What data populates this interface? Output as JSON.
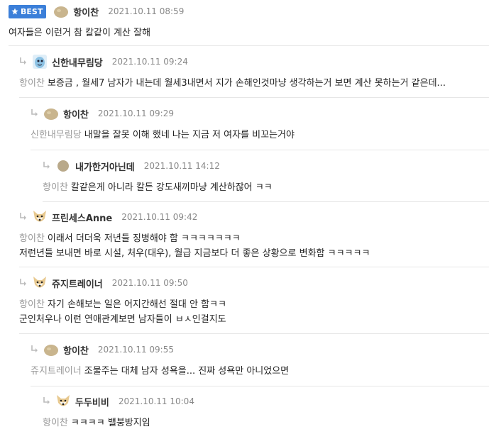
{
  "colors": {
    "best_badge": "#3b7fd9",
    "mention": "#999999",
    "meta": "#888888",
    "divider": "#e6e6e6"
  },
  "comments": [
    {
      "badge": "BEST",
      "nick": "항이찬",
      "time": "2021.10.11 08:59",
      "avatar": "potato-avatar",
      "body": "여자들은 이런거 참 칼같이 계산 잘해"
    },
    {
      "nick": "신한내무림당",
      "time": "2021.10.11 09:24",
      "avatar": "blue-character-avatar",
      "mention": "항이찬",
      "body": "보증금 , 월세7 남자가 내는데 월세3내면서 지가 손해인것마냥 생각하는거 보면 계산 못하는거 같은데..."
    },
    {
      "nick": "항이찬",
      "time": "2021.10.11 09:29",
      "avatar": "potato-avatar",
      "mention": "신한내무림당",
      "body": "내말을 잘못 이해 했네 나는 지금 저 여자를 비꼬는거야"
    },
    {
      "nick": "내가한거아닌데",
      "time": "2021.10.11 14:12",
      "avatar": "circle-avatar",
      "mention": "항이찬",
      "body": "칼같은게 아니라 칼든 강도새끼마냥 계산하잖어 ㅋㅋ"
    },
    {
      "nick": "프린세스Anne",
      "time": "2021.10.11 09:42",
      "avatar": "dog-avatar",
      "mention": "항이찬",
      "body": "이래서 더더욱 저년들 징병해야 함 ㅋㅋㅋㅋㅋㅋㅋ",
      "body2": "저런년들 보내면 바로 시설, 처우(대우), 월급 지금보다 더 좋은 상황으로 변화함 ㅋㅋㅋㅋㅋ"
    },
    {
      "nick": "쥬지트레이너",
      "time": "2021.10.11 09:50",
      "avatar": "dog-avatar",
      "mention": "항이찬",
      "body": "자기 손해보는 일은 어지간해선 절대 안 함ㅋㅋ",
      "body2": "군인처우나 이런 연애관계보면 남자들이 ㅂㅅ인걸지도"
    },
    {
      "nick": "항이찬",
      "time": "2021.10.11 09:55",
      "avatar": "potato-avatar",
      "mention": "쥬지트레이너",
      "body": "조물주는 대체 남자 성욕을... 진짜 성욕만 아니었으면"
    },
    {
      "nick": "두두비비",
      "time": "2021.10.11 10:04",
      "avatar": "dog-avatar",
      "mention": "항이찬",
      "body": "ㅋㅋㅋㅋ 밸붕방지임"
    }
  ]
}
